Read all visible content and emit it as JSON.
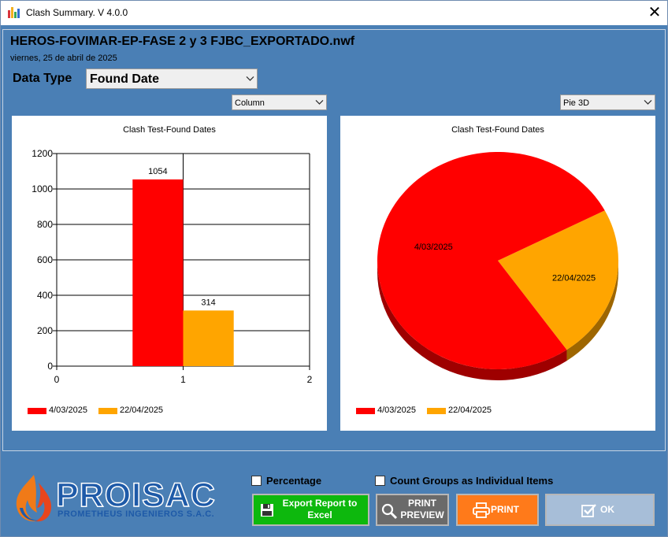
{
  "window": {
    "title": "Clash Summary. V 4.0.0",
    "close_glyph": "✕"
  },
  "header": {
    "file_title": "HEROS-FOVIMAR-EP-FASE 2 y 3 FJBC_EXPORTADO.nwf",
    "date": "viernes, 25 de abril de 2025",
    "data_type_label": "Data Type",
    "data_type_value": "Found Date"
  },
  "left_chart": {
    "type_select": "Column"
  },
  "right_chart": {
    "type_select": "Pie 3D"
  },
  "chart_data": [
    {
      "type": "bar",
      "title": "Clash Test-Found Dates",
      "x": [
        1
      ],
      "series": [
        {
          "name": "4/03/2025",
          "values": [
            1054
          ],
          "color": "#ff0000"
        },
        {
          "name": "22/04/2025",
          "values": [
            314
          ],
          "color": "#ffa500"
        }
      ],
      "xlim": [
        0,
        2
      ],
      "ylim": [
        0,
        1200
      ],
      "x_ticks": [
        0,
        1,
        2
      ],
      "y_ticks": [
        0,
        200,
        400,
        600,
        800,
        1000,
        1200
      ],
      "grid": true,
      "legend": "bottom-left"
    },
    {
      "type": "pie",
      "title": "Clash Test-Found Dates",
      "categories": [
        "4/03/2025",
        "22/04/2025"
      ],
      "values": [
        1054,
        314
      ],
      "colors": [
        "#ff0000",
        "#ffa500"
      ],
      "legend": "bottom-left"
    }
  ],
  "options": {
    "percentage_label": "Percentage",
    "percentage_checked": false,
    "count_groups_label": "Count Groups as Individual Items",
    "count_groups_checked": false
  },
  "buttons": {
    "export_label": "Export Report to Excel",
    "print_preview_label": "PRINT PREVIEW",
    "print_label": "PRINT",
    "ok_label": "OK"
  },
  "logo": {
    "name": "PROISAC",
    "subtitle": "PROMETHEUS INGENIEROS S.A.C."
  },
  "colors": {
    "background": "#4a7fb5",
    "export_button": "#0db80d",
    "print_preview_button": "#6a6a6a",
    "print_button": "#ff7a1a",
    "ok_button": "#a7bed8"
  }
}
